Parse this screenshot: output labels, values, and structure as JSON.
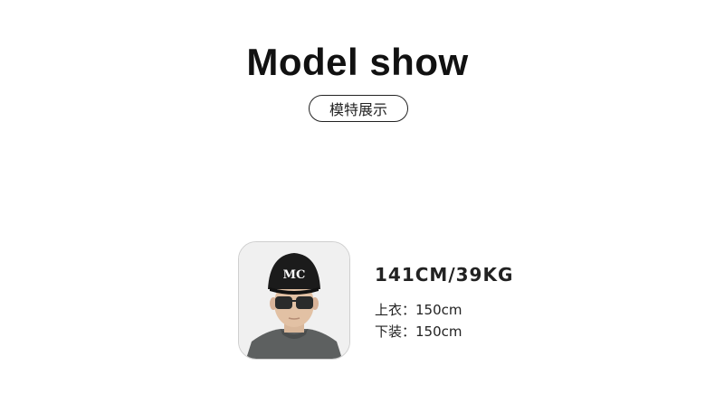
{
  "header": {
    "title": "Model show",
    "subtitle": "模特展示"
  },
  "model": {
    "avatar_cap_text": "MC",
    "measurements": "141CM/39KG",
    "top_label": "上衣：",
    "top_size": "150cm",
    "bottom_label": "下装：",
    "bottom_size": "150cm"
  }
}
